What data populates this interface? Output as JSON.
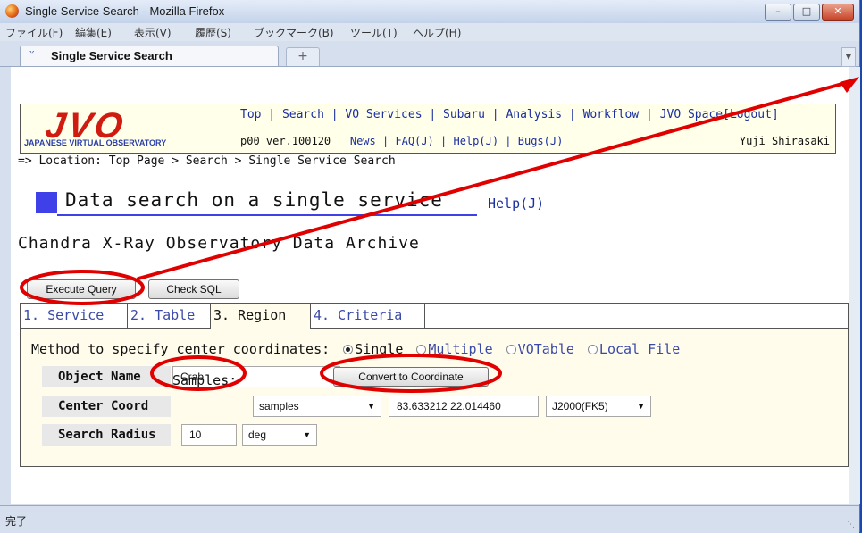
{
  "window": {
    "title": "Single Service Search - Mozilla Firefox",
    "min_glyph": "–",
    "max_glyph": "□",
    "close_glyph": "✕"
  },
  "menu": [
    "ファイル(F)",
    "編集(E)",
    "表示(V)",
    "履歴(S)",
    "ブックマーク(B)",
    "ツール(T)",
    "ヘルプ(H)"
  ],
  "browser_tab": {
    "label": "Single Service Search",
    "icon": "jvo-favicon-icon",
    "new_tab_glyph": "+"
  },
  "header": {
    "logo": "JVO",
    "logo_sub": "JAPANESE VIRTUAL OBSERVATORY",
    "nav": [
      "Top",
      "Search",
      "VO Services",
      "Subaru",
      "Analysis",
      "Workflow",
      "JVO Space"
    ],
    "logout": "[Logout]",
    "version": "p00 ver.100120",
    "sub_links": [
      "News",
      "FAQ(J)",
      "Help(J)",
      "Bugs(J)"
    ],
    "user": "Yuji Shirasaki"
  },
  "breadcrumb": {
    "prefix": "=> Location:",
    "items": [
      "Top Page",
      "Search",
      "Single Service Search"
    ]
  },
  "page": {
    "heading": "Data search on a single service",
    "help_link": "Help(J)",
    "archive_title": "Chandra X-Ray Observatory Data Archive"
  },
  "buttons": {
    "execute": "Execute Query",
    "check_sql": "Check SQL",
    "convert": "Convert to Coordinate"
  },
  "tabs": [
    {
      "label": "1. Service",
      "active": false
    },
    {
      "label": "2. Table",
      "active": false
    },
    {
      "label": "3. Region",
      "active": true
    },
    {
      "label": "4. Criteria",
      "active": false
    }
  ],
  "region": {
    "method_label": "Method to specify center coordinates:",
    "methods": [
      {
        "label": "Single",
        "selected": true
      },
      {
        "label": "Multiple",
        "selected": false
      },
      {
        "label": "VOTable",
        "selected": false
      },
      {
        "label": "Local File",
        "selected": false
      }
    ],
    "object_name_label": "Object Name",
    "object_name_value": "Crab",
    "center_coord_label": "Center Coord",
    "samples_label": "Samples:",
    "samples_selected": "samples",
    "coord_value": "83.633212 22.014460",
    "coord_system": "J2000(FK5)",
    "search_radius_label": "Search Radius",
    "radius_value": "10",
    "radius_unit": "deg"
  },
  "status": {
    "text": "完了"
  },
  "colors": {
    "annotation": "#e00000",
    "link": "#1a2fa0",
    "logo": "#d01c10",
    "heading_accent": "#4040e8",
    "panel_bg": "#fffcec"
  }
}
